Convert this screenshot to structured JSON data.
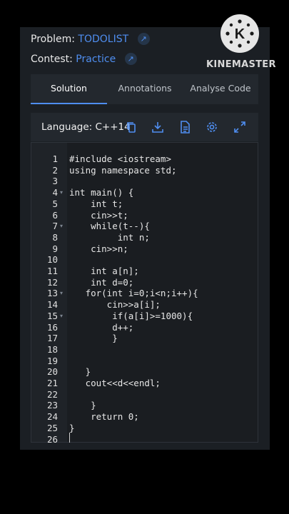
{
  "problem": {
    "label": "Problem:",
    "value": "TODOLIST"
  },
  "contest": {
    "label": "Contest:",
    "value": "Practice"
  },
  "tabs": [
    {
      "label": "Solution",
      "active": true
    },
    {
      "label": "Annotations",
      "active": false
    },
    {
      "label": "Analyse Code",
      "active": false
    }
  ],
  "language": {
    "label": "Language:",
    "value": "C++14"
  },
  "toolbar_icons": [
    "copy-icon",
    "download-icon",
    "file-icon",
    "settings-icon",
    "expand-icon"
  ],
  "editor": {
    "line_numbers": [
      "1",
      "2",
      "3",
      "4",
      "5",
      "6",
      "7",
      "8",
      "9",
      "10",
      "11",
      "12",
      "13",
      "14",
      "15",
      "16",
      "17",
      "18",
      "19",
      "20",
      "21",
      "22",
      "23",
      "24",
      "25",
      "26"
    ],
    "lines": [
      "#include <iostream>",
      "using namespace std;",
      "",
      "int main() {",
      "    int t;",
      "    cin>>t;",
      "    while(t--){",
      "         int n;",
      "    cin>>n;",
      "",
      "    int a[n];",
      "    int d=0;",
      "   for(int i=0;i<n;i++){",
      "       cin>>a[i];",
      "        if(a[i]>=1000){",
      "        d++;",
      "        }",
      "",
      "",
      "   }",
      "   cout<<d<<endl;",
      "",
      "    }",
      "    return 0;",
      "}",
      ""
    ],
    "foldable_lines": [
      "4",
      "7",
      "13",
      "15"
    ]
  },
  "watermark": {
    "text": "KINEMASTER",
    "glyph": "K"
  },
  "colors": {
    "accent": "#4f8ef0",
    "panel": "#1b1f24",
    "background": "#000000"
  }
}
